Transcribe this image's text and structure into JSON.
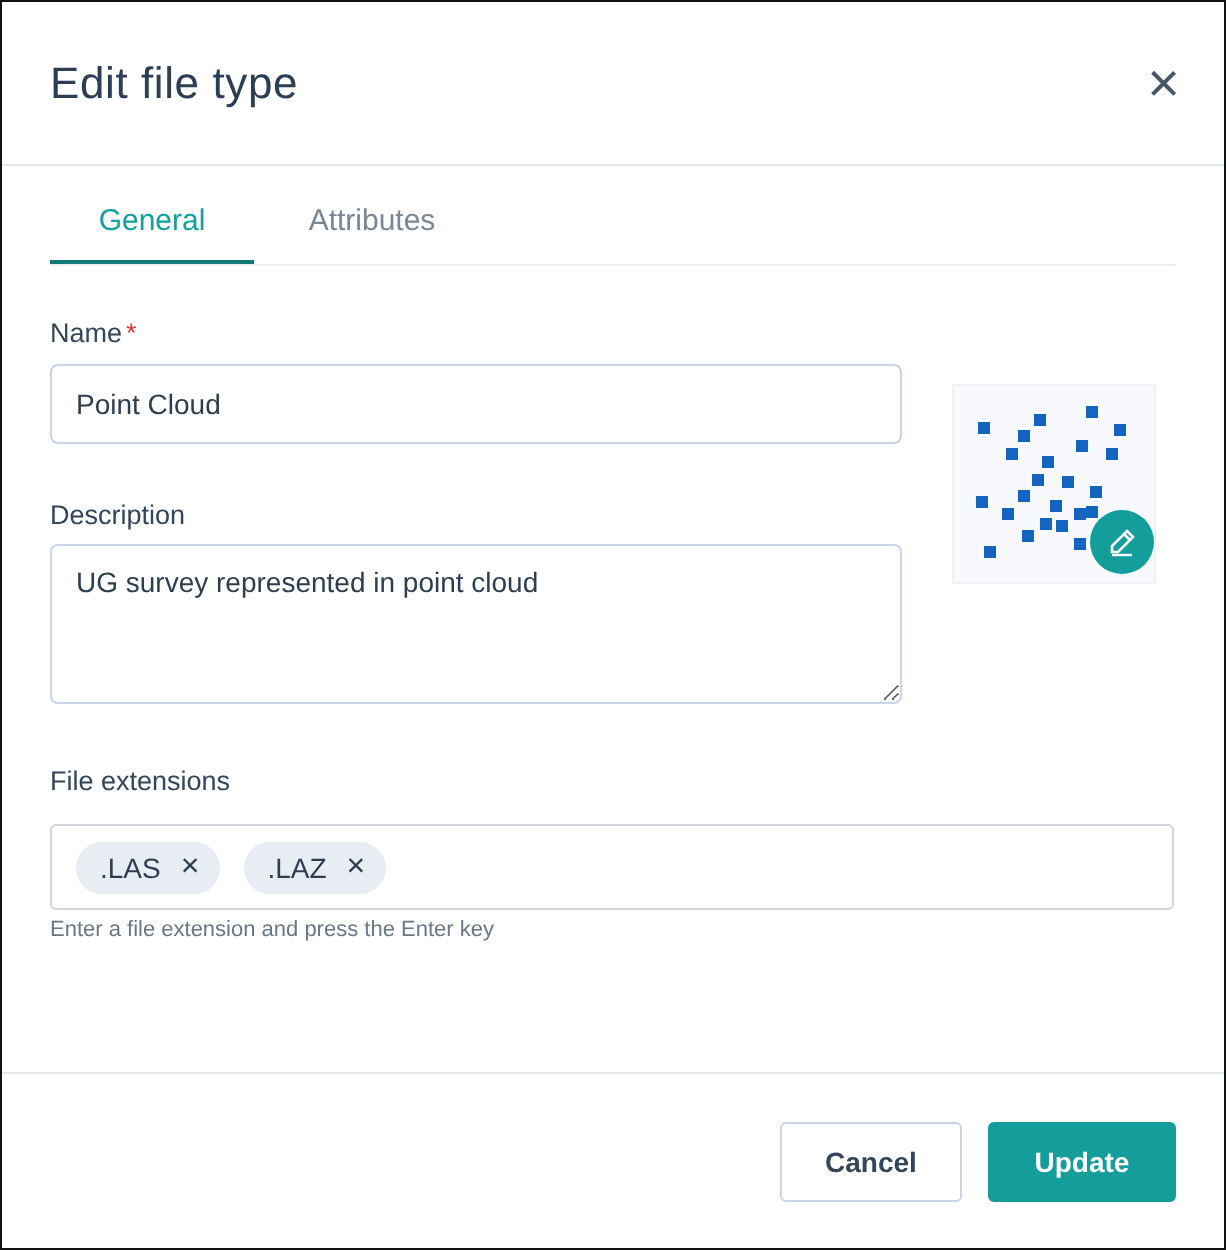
{
  "dialog": {
    "title": "Edit file type",
    "close": "×"
  },
  "tabs": [
    {
      "label": "General",
      "selected": true
    },
    {
      "label": "Attributes",
      "selected": false
    }
  ],
  "name_field": {
    "label": "Name",
    "required_mark": "*",
    "value": "Point Cloud"
  },
  "description_field": {
    "label": "Description",
    "value": "UG survey represented in point cloud"
  },
  "extensions_field": {
    "label": "File extensions",
    "tags": [
      {
        "label": ".LAS",
        "remove": "×"
      },
      {
        "label": ".LAZ",
        "remove": "×"
      }
    ],
    "hint": "Enter a file extension and press the Enter key"
  },
  "buttons": [
    {
      "label": "Cancel",
      "kind": "secondary"
    },
    {
      "label": "Update",
      "kind": "primary"
    }
  ]
}
